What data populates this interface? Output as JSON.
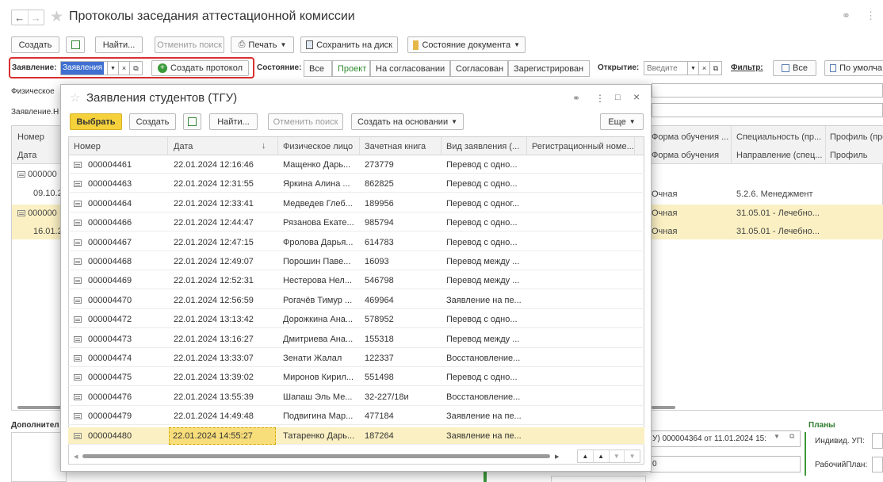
{
  "window": {
    "title": "Протоколы заседания аттестационной комиссии"
  },
  "toolbar": {
    "create": "Создать",
    "find": "Найти...",
    "cancel_search": "Отменить поиск",
    "print": "Печать",
    "save_disk": "Сохранить на диск",
    "doc_state": "Состояние документа"
  },
  "filters": {
    "zayavlenie_label": "Заявление:",
    "zayavlenie_value": "Заявления",
    "create_protocol": "Создать протокол",
    "state_label": "Состояние:",
    "states": [
      "Все",
      "Проект",
      "На согласовании",
      "Согласован",
      "Зарегистрирован"
    ],
    "open_label": "Открытие:",
    "open_placeholder": "Введите",
    "filter_label": "Фильтр:",
    "filter_all": "Все",
    "filter_default": "По умолча"
  },
  "background": {
    "left_labels": [
      "Физическое",
      "Заявление.Н"
    ],
    "grid_left_headers": [
      "Номер",
      "Дата"
    ],
    "grid_left_rows": [
      "000000",
      "09.10.2",
      "000000",
      "16.01.2"
    ],
    "right_headers_row1": [
      "Форма обучения ...",
      "Специальность (пр...",
      "Профиль (пре"
    ],
    "right_headers_row2": [
      "Форма обучения",
      "Направление (спец...",
      "Профиль"
    ],
    "right_rows": [
      [
        "Очная",
        "5.2.6. Менеджмент"
      ],
      [
        "Очная",
        "31.05.01 - Лечебно..."
      ],
      [
        "Очная",
        "31.05.01 - Лечебно..."
      ]
    ],
    "bottom_left": "Дополнител",
    "bottom_doc": "У) 000004364 от 11.01.2024 15:",
    "bottom_field2": "0",
    "plans_title": "Планы",
    "plans_ind": "Индивид. УП:",
    "plans_work": "РабочийПлан:"
  },
  "dialog": {
    "title": "Заявления студентов (ТГУ)",
    "select": "Выбрать",
    "create": "Создать",
    "find": "Найти...",
    "cancel_search": "Отменить поиск",
    "create_based": "Создать на основании",
    "more": "Еще",
    "columns": [
      "Номер",
      "Дата",
      "Физическое лицо",
      "Зачетная книга",
      "Вид заявления (...",
      "Регистрационный номе..."
    ],
    "rows": [
      [
        "000004461",
        "22.01.2024 12:16:46",
        "Мащенко Дарь...",
        "273779",
        "Перевод  с одно..."
      ],
      [
        "000004463",
        "22.01.2024 12:31:55",
        "Яркина Алина ...",
        "862825",
        "Перевод  с одно..."
      ],
      [
        "000004464",
        "22.01.2024 12:33:41",
        "Медведев Глеб...",
        "189956",
        "Перевод с одног..."
      ],
      [
        "000004466",
        "22.01.2024 12:44:47",
        "Рязанова Екате...",
        "985794",
        "Перевод  с одно..."
      ],
      [
        "000004467",
        "22.01.2024 12:47:15",
        "Фролова Дарья...",
        "614783",
        "Перевод  с одно..."
      ],
      [
        "000004468",
        "22.01.2024 12:49:07",
        "Порошин Паве...",
        "16093",
        "Перевод между ..."
      ],
      [
        "000004469",
        "22.01.2024 12:52:31",
        "Нестерова Нел...",
        "546798",
        "Перевод между ..."
      ],
      [
        "000004470",
        "22.01.2024 12:56:59",
        "Рогачёв Тимур ...",
        "469964",
        "Заявление на пе..."
      ],
      [
        "000004472",
        "22.01.2024 13:13:42",
        "Дорожкина Ана...",
        "578952",
        "Перевод  с одно..."
      ],
      [
        "000004473",
        "22.01.2024 13:16:27",
        "Дмитриева Ана...",
        "155318",
        "Перевод между ..."
      ],
      [
        "000004474",
        "22.01.2024 13:33:07",
        "Зенати Жалал",
        "122337",
        "Восстановление..."
      ],
      [
        "000004475",
        "22.01.2024 13:39:02",
        "Миронов Кирил...",
        "551498",
        "Перевод  с одно..."
      ],
      [
        "000004476",
        "22.01.2024 13:55:39",
        "Шапаш Эль Ме...",
        "32-227/18и",
        "Восстановление..."
      ],
      [
        "000004479",
        "22.01.2024 14:49:48",
        "Подвигина Мар...",
        "477184",
        "Заявление на пе..."
      ],
      [
        "000004480",
        "22.01.2024 14:55:27",
        "Татаренко Дарь...",
        "187264",
        "Заявление на пе..."
      ]
    ]
  },
  "colors": {
    "accent_yellow": "#f5d23c",
    "highlight_row": "#fbf0c3",
    "red_outline": "#d93030",
    "green": "#3a9a3a"
  }
}
